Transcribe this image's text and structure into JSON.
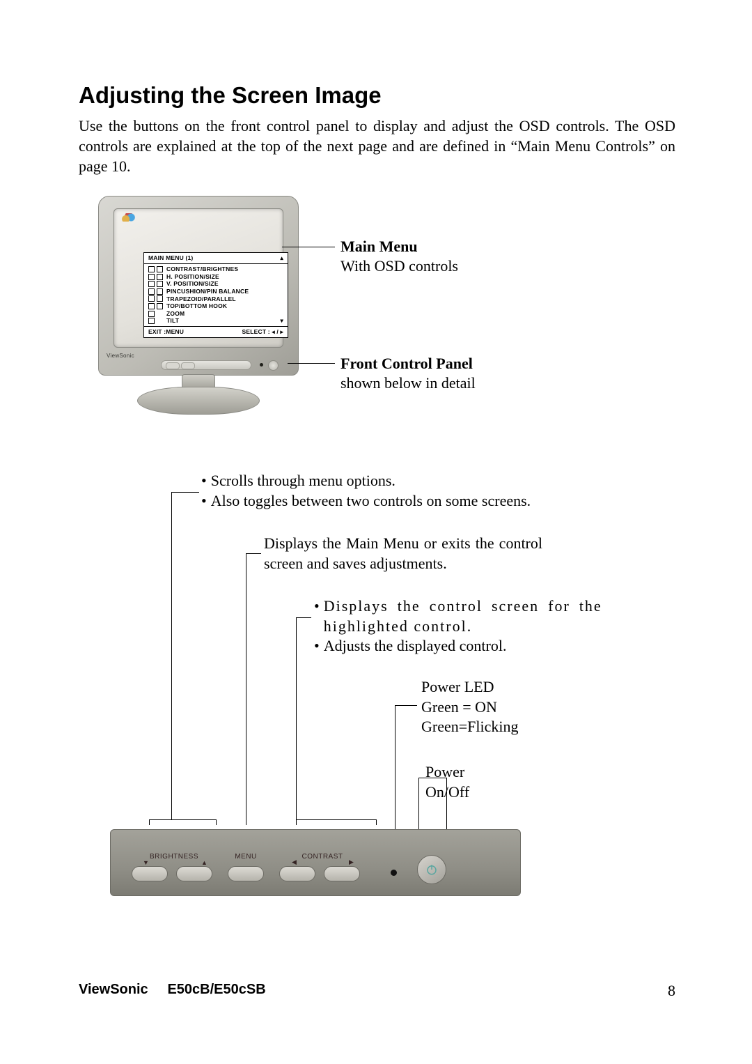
{
  "heading": "Adjusting the Screen Image",
  "intro": "Use the buttons on the front control panel to display and adjust the OSD controls. The OSD controls are explained at the top of the next page and are defined in “Main Menu Controls” on page 10.",
  "osd": {
    "title": "MAIN MENU (1)",
    "arrow_up": "▴",
    "items": [
      "CONTRAST/BRIGHTNES",
      "H. POSITION/SIZE",
      "V. POSITION/SIZE",
      "PINCUSHION/PIN BALANCE",
      "TRAPEZOID/PARALLEL",
      "TOP/BOTTOM HOOK",
      "ZOOM",
      "TILT"
    ],
    "arrow_down": "▾",
    "footer_left": "EXIT :MENU",
    "footer_right": "SELECT : ◂ / ▸"
  },
  "monitor_brand": "ViewSonic",
  "callouts": {
    "main_menu": {
      "title": "Main Menu",
      "sub": "With OSD controls"
    },
    "front_panel": {
      "title": "Front Control Panel",
      "sub": "shown below in detail"
    }
  },
  "diagram": {
    "scroll": {
      "line1": "Scrolls through menu options.",
      "line2": "Also toggles between two controls on some screens."
    },
    "menu": {
      "line1": "Displays the Main Menu or exits the control screen and saves adjustments."
    },
    "contrast": {
      "line1": "Displays the control screen for the highlighted control.",
      "line2": "Adjusts the displayed control."
    },
    "led": {
      "line1": "Power LED",
      "line2": "Green = ON",
      "line3": "Green=Flicking"
    },
    "power": {
      "line1": "Power",
      "line2": "On/Off"
    },
    "panel_labels": {
      "brightness": "BRIGHTNESS",
      "menu": "MENU",
      "contrast": "CONTRAST"
    },
    "arrows": {
      "down": "▼",
      "up": "▲",
      "left": "◀",
      "right": "▶"
    }
  },
  "footer": {
    "brand": "ViewSonic",
    "model": "E50cB/E50cSB",
    "page": "8"
  }
}
